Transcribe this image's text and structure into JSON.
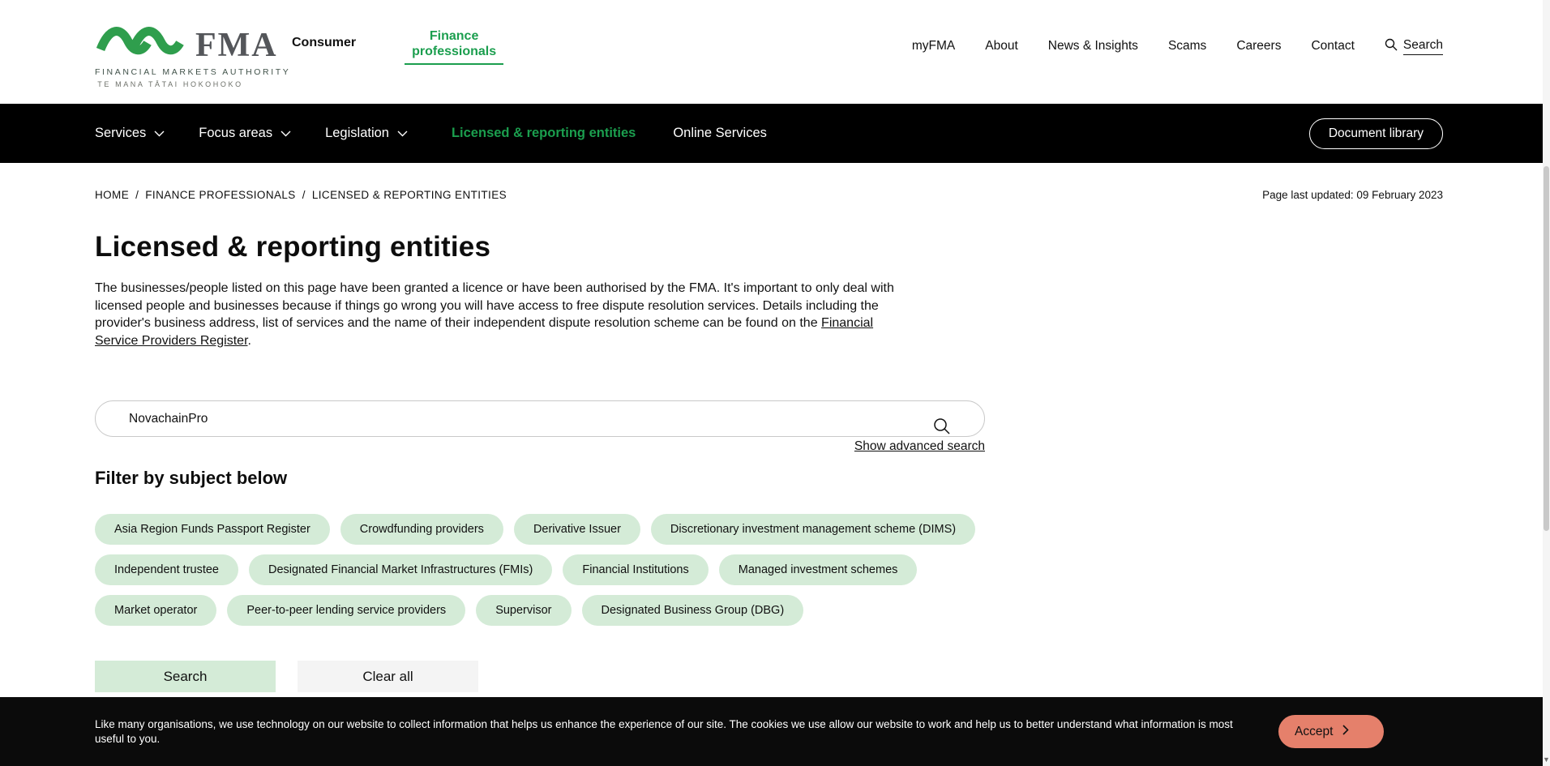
{
  "brand": {
    "acronym": "FMA",
    "line1": "FINANCIAL MARKETS AUTHORITY",
    "line2": "TE MANA TĀTAI HOKOHOKO"
  },
  "header": {
    "tabs": [
      {
        "label": "Consumer",
        "active": false
      },
      {
        "label": "Finance professionals",
        "active": true
      }
    ],
    "links": [
      "myFMA",
      "About",
      "News & Insights",
      "Scams",
      "Careers",
      "Contact"
    ],
    "search_label": "Search"
  },
  "nav": {
    "items": [
      {
        "label": "Services",
        "has_dropdown": true
      },
      {
        "label": "Focus areas",
        "has_dropdown": true
      },
      {
        "label": "Legislation",
        "has_dropdown": true
      },
      {
        "label": "Licensed & reporting entities",
        "has_dropdown": false,
        "active": true
      },
      {
        "label": "Online Services",
        "has_dropdown": false
      }
    ],
    "document_library": "Document library"
  },
  "breadcrumb": {
    "home": "HOME",
    "sep": "/",
    "section": "FINANCE PROFESSIONALS",
    "current": "LICENSED & REPORTING ENTITIES"
  },
  "meta": {
    "last_updated": "Page last updated: 09 February 2023"
  },
  "page": {
    "title": "Licensed & reporting entities",
    "intro": "The businesses/people listed on this page have been granted a licence or have been authorised by the FMA. It's important to only deal with licensed people and businesses because if things go wrong you will have access to free dispute resolution services. Details including the provider's business address, list of services and the name of their independent dispute resolution scheme can be found on the ",
    "intro_link": "Financial Service Providers Register",
    "intro_end": "."
  },
  "search": {
    "value": "NovachainPro",
    "advanced": "Show advanced search"
  },
  "filters": {
    "heading": "Filter by subject below",
    "rows": [
      [
        "Asia Region Funds Passport Register",
        "Crowdfunding providers",
        "Derivative Issuer",
        "Discretionary investment management scheme (DIMS)"
      ],
      [
        "Independent trustee",
        "Designated Financial Market Infrastructures (FMIs)",
        "Financial Institutions",
        "Managed investment schemes"
      ],
      [
        "Market operator",
        "Peer-to-peer lending service providers",
        "Supervisor",
        "Designated Business Group (DBG)"
      ]
    ],
    "search_button": "Search",
    "clear_button": "Clear all"
  },
  "cookies": {
    "message": "Like many organisations, we use technology on our website to collect information that helps us enhance the experience of our site. The cookies we use allow our website to work and help us to better understand what information is most useful to you.",
    "accept": "Accept"
  },
  "colors": {
    "green": "#1b9e4e",
    "pill_bg": "#d4ebd7",
    "accept_bg": "#e5806b",
    "nav_bg": "#000000"
  }
}
